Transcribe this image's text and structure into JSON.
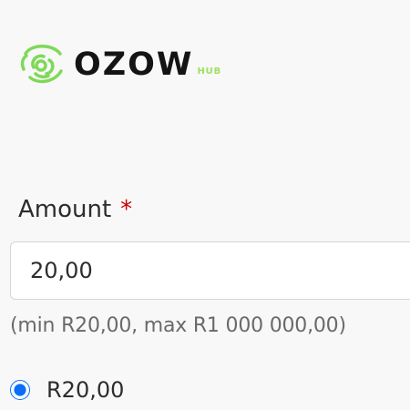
{
  "brand": {
    "logo_icon": "ozow-eye-icon",
    "name": "OZOW",
    "suffix": "HUB",
    "accent_color": "#7ed957",
    "suffix_color": "#9be15d"
  },
  "form": {
    "amount_label": "Amount",
    "required_marker": "*",
    "amount_value": "20,00",
    "amount_hint": "(min R20,00, max R1 000 000,00)",
    "options": [
      {
        "label": "R20,00",
        "selected": true
      }
    ]
  },
  "colors": {
    "required": "#cc0000",
    "radio_selected": "#0b6ef8"
  }
}
